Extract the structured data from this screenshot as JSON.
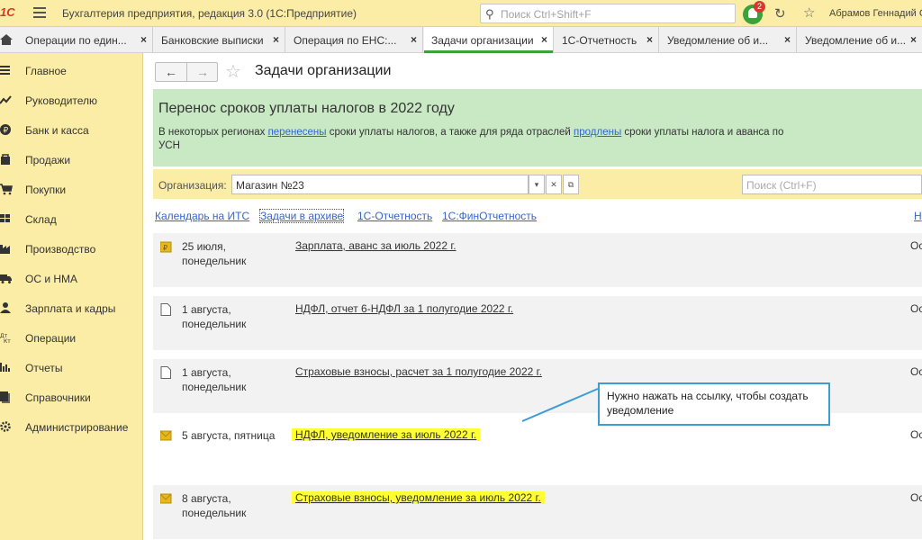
{
  "titlebar": {
    "logo": "1С",
    "app_title": "Бухгалтерия предприятия, редакция 3.0  (1С:Предприятие)",
    "search_placeholder": "Поиск Ctrl+Shift+F",
    "notification_count": "2",
    "user_name": "Абрамов Геннадий С"
  },
  "tabs": [
    {
      "label": "Операции по един...",
      "close": "×"
    },
    {
      "label": "Банковские выписки",
      "close": "×"
    },
    {
      "label": "Операция по ЕНС:...",
      "close": "×"
    },
    {
      "label": "Задачи организации",
      "close": "×"
    },
    {
      "label": "1С-Отчетность",
      "close": "×"
    },
    {
      "label": "Уведомление об и...",
      "close": "×"
    },
    {
      "label": "Уведомление об и...",
      "close": "×"
    }
  ],
  "sidebar": {
    "items": [
      {
        "label": "Главное",
        "icon": "menu-icon"
      },
      {
        "label": "Руководителю",
        "icon": "chart-line-icon"
      },
      {
        "label": "Банк и касса",
        "icon": "coin-icon"
      },
      {
        "label": "Продажи",
        "icon": "bag-icon"
      },
      {
        "label": "Покупки",
        "icon": "cart-icon"
      },
      {
        "label": "Склад",
        "icon": "warehouse-icon"
      },
      {
        "label": "Производство",
        "icon": "factory-icon"
      },
      {
        "label": "ОС и НМА",
        "icon": "truck-icon"
      },
      {
        "label": "Зарплата и кадры",
        "icon": "person-icon"
      },
      {
        "label": "Операции",
        "icon": "operations-icon"
      },
      {
        "label": "Отчеты",
        "icon": "bar-chart-icon"
      },
      {
        "label": "Справочники",
        "icon": "book-icon"
      },
      {
        "label": "Администрирование",
        "icon": "gear-icon"
      }
    ]
  },
  "main": {
    "title": "Задачи организации",
    "banner": {
      "title": "Перенос сроков уплаты налогов в 2022 году",
      "text_1": "В некоторых регионах ",
      "link_1": "перенесены",
      "text_2": " сроки уплаты налогов, а также для ряда отраслей ",
      "link_2": "продлены",
      "text_3": " сроки уплаты налога и аванса по УСН"
    },
    "org_label": "Организация:",
    "org_value": "Магазин №23",
    "org_search_placeholder": "Поиск (Ctrl+F)",
    "links": [
      "Календарь на ИТС",
      "Задачи в архиве",
      "1С-Отчетность",
      "1С:ФинОтчетность",
      "Н"
    ],
    "tasks": [
      {
        "date_1": "25 июля,",
        "date_2": "понедельник",
        "name": "Зарплата, аванс за июль 2022 г.",
        "status": "Ос",
        "icon": "payment-icon",
        "highlight": false
      },
      {
        "date_1": "1 августа,",
        "date_2": "понедельник",
        "name": "НДФЛ, отчет 6-НДФЛ за 1 полугодие 2022 г.",
        "status": "Ос",
        "icon": "document-icon",
        "highlight": false
      },
      {
        "date_1": "1 августа,",
        "date_2": "понедельник",
        "name": "Страховые взносы, расчет за 1 полугодие 2022 г.",
        "status": "Ос",
        "icon": "document-icon",
        "highlight": false
      },
      {
        "date_1": "5 августа, пятница",
        "date_2": "",
        "name": "НДФЛ, уведомление за июль 2022 г.",
        "status": "Ос",
        "icon": "envelope-icon",
        "highlight": true
      },
      {
        "date_1": "8 августа,",
        "date_2": "понедельник",
        "name": "Страховые взносы, уведомление за июль 2022 г.",
        "status": "Ос",
        "icon": "envelope-icon",
        "highlight": true
      }
    ]
  },
  "callout": {
    "text_1": "Нужно нажать на ссылку, чтобы создать",
    "text_2": "уведомление"
  },
  "colors": {
    "accent_green": "#3aa13b",
    "sidebar_bg": "#fbeda6",
    "banner_bg": "#c9e9c4",
    "highlight": "#ffff33",
    "callout_border": "#3d9bd6",
    "link": "#3366cc"
  }
}
